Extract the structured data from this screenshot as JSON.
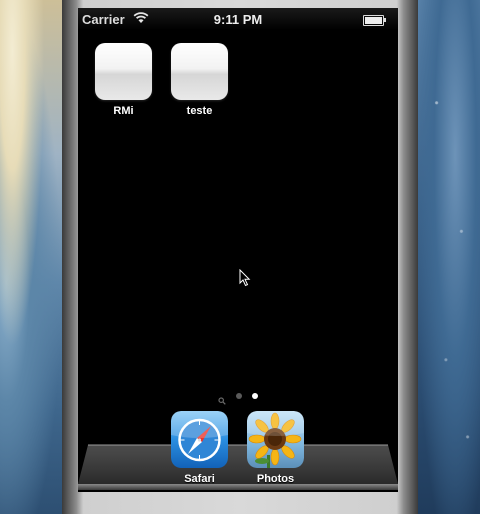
{
  "status_bar": {
    "carrier": "Carrier",
    "time": "9:11 PM",
    "wifi_icon": "wifi-icon",
    "battery_icon": "battery-icon"
  },
  "home_screen": {
    "apps": [
      {
        "label": "RMi",
        "icon": "blank-app-icon"
      },
      {
        "label": "teste",
        "icon": "blank-app-icon"
      }
    ]
  },
  "page_indicator": {
    "pages": 3,
    "current_page": 3,
    "first_is_spotlight": true
  },
  "dock": {
    "apps": [
      {
        "label": "Safari",
        "icon": "safari-compass-icon"
      },
      {
        "label": "Photos",
        "icon": "photos-sunflower-icon"
      }
    ]
  },
  "colors": {
    "screen_background": "#000000",
    "label_text": "#ffffff"
  }
}
